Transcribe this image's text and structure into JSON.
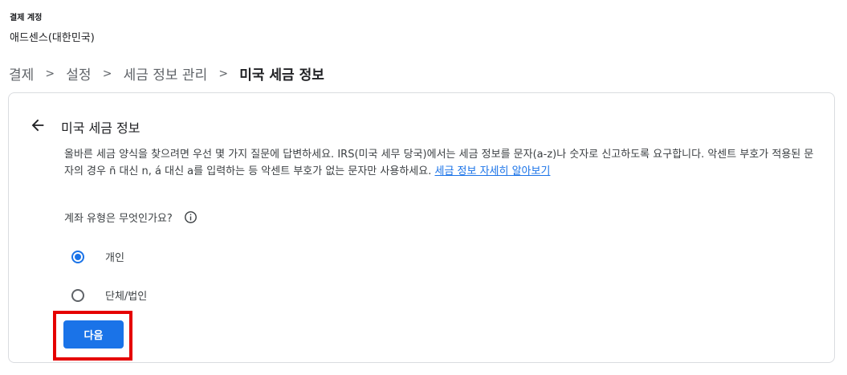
{
  "account": {
    "label": "결제 계정",
    "name": "애드센스(대한민국)"
  },
  "breadcrumb": {
    "items": [
      "결제",
      "설정",
      "세금 정보 관리"
    ],
    "current": "미국 세금 정보",
    "separator": ">"
  },
  "card": {
    "title": "미국 세금 정보",
    "description_text": "올바른 세금 양식을 찾으려면 우선 몇 가지 질문에 답변하세요. IRS(미국 세무 당국)에서는 세금 정보를 문자(a-z)나 숫자로 신고하도록 요구합니다. 악센트 부호가 적용된 문자의 경우 ñ 대신 n, á 대신 a를 입력하는 등 악센트 부호가 없는 문자만 사용하세요.",
    "learn_more_link": "세금 정보 자세히 알아보기",
    "question": "계좌 유형은 무엇인가요?",
    "options": [
      {
        "label": "개인",
        "selected": true
      },
      {
        "label": "단체/법인",
        "selected": false
      }
    ],
    "next_button": "다음"
  },
  "colors": {
    "accent": "#1a73e8",
    "highlight": "#e50000",
    "border": "#dadce0"
  },
  "icons": {
    "back": "arrow-back-icon",
    "info": "info-icon"
  }
}
